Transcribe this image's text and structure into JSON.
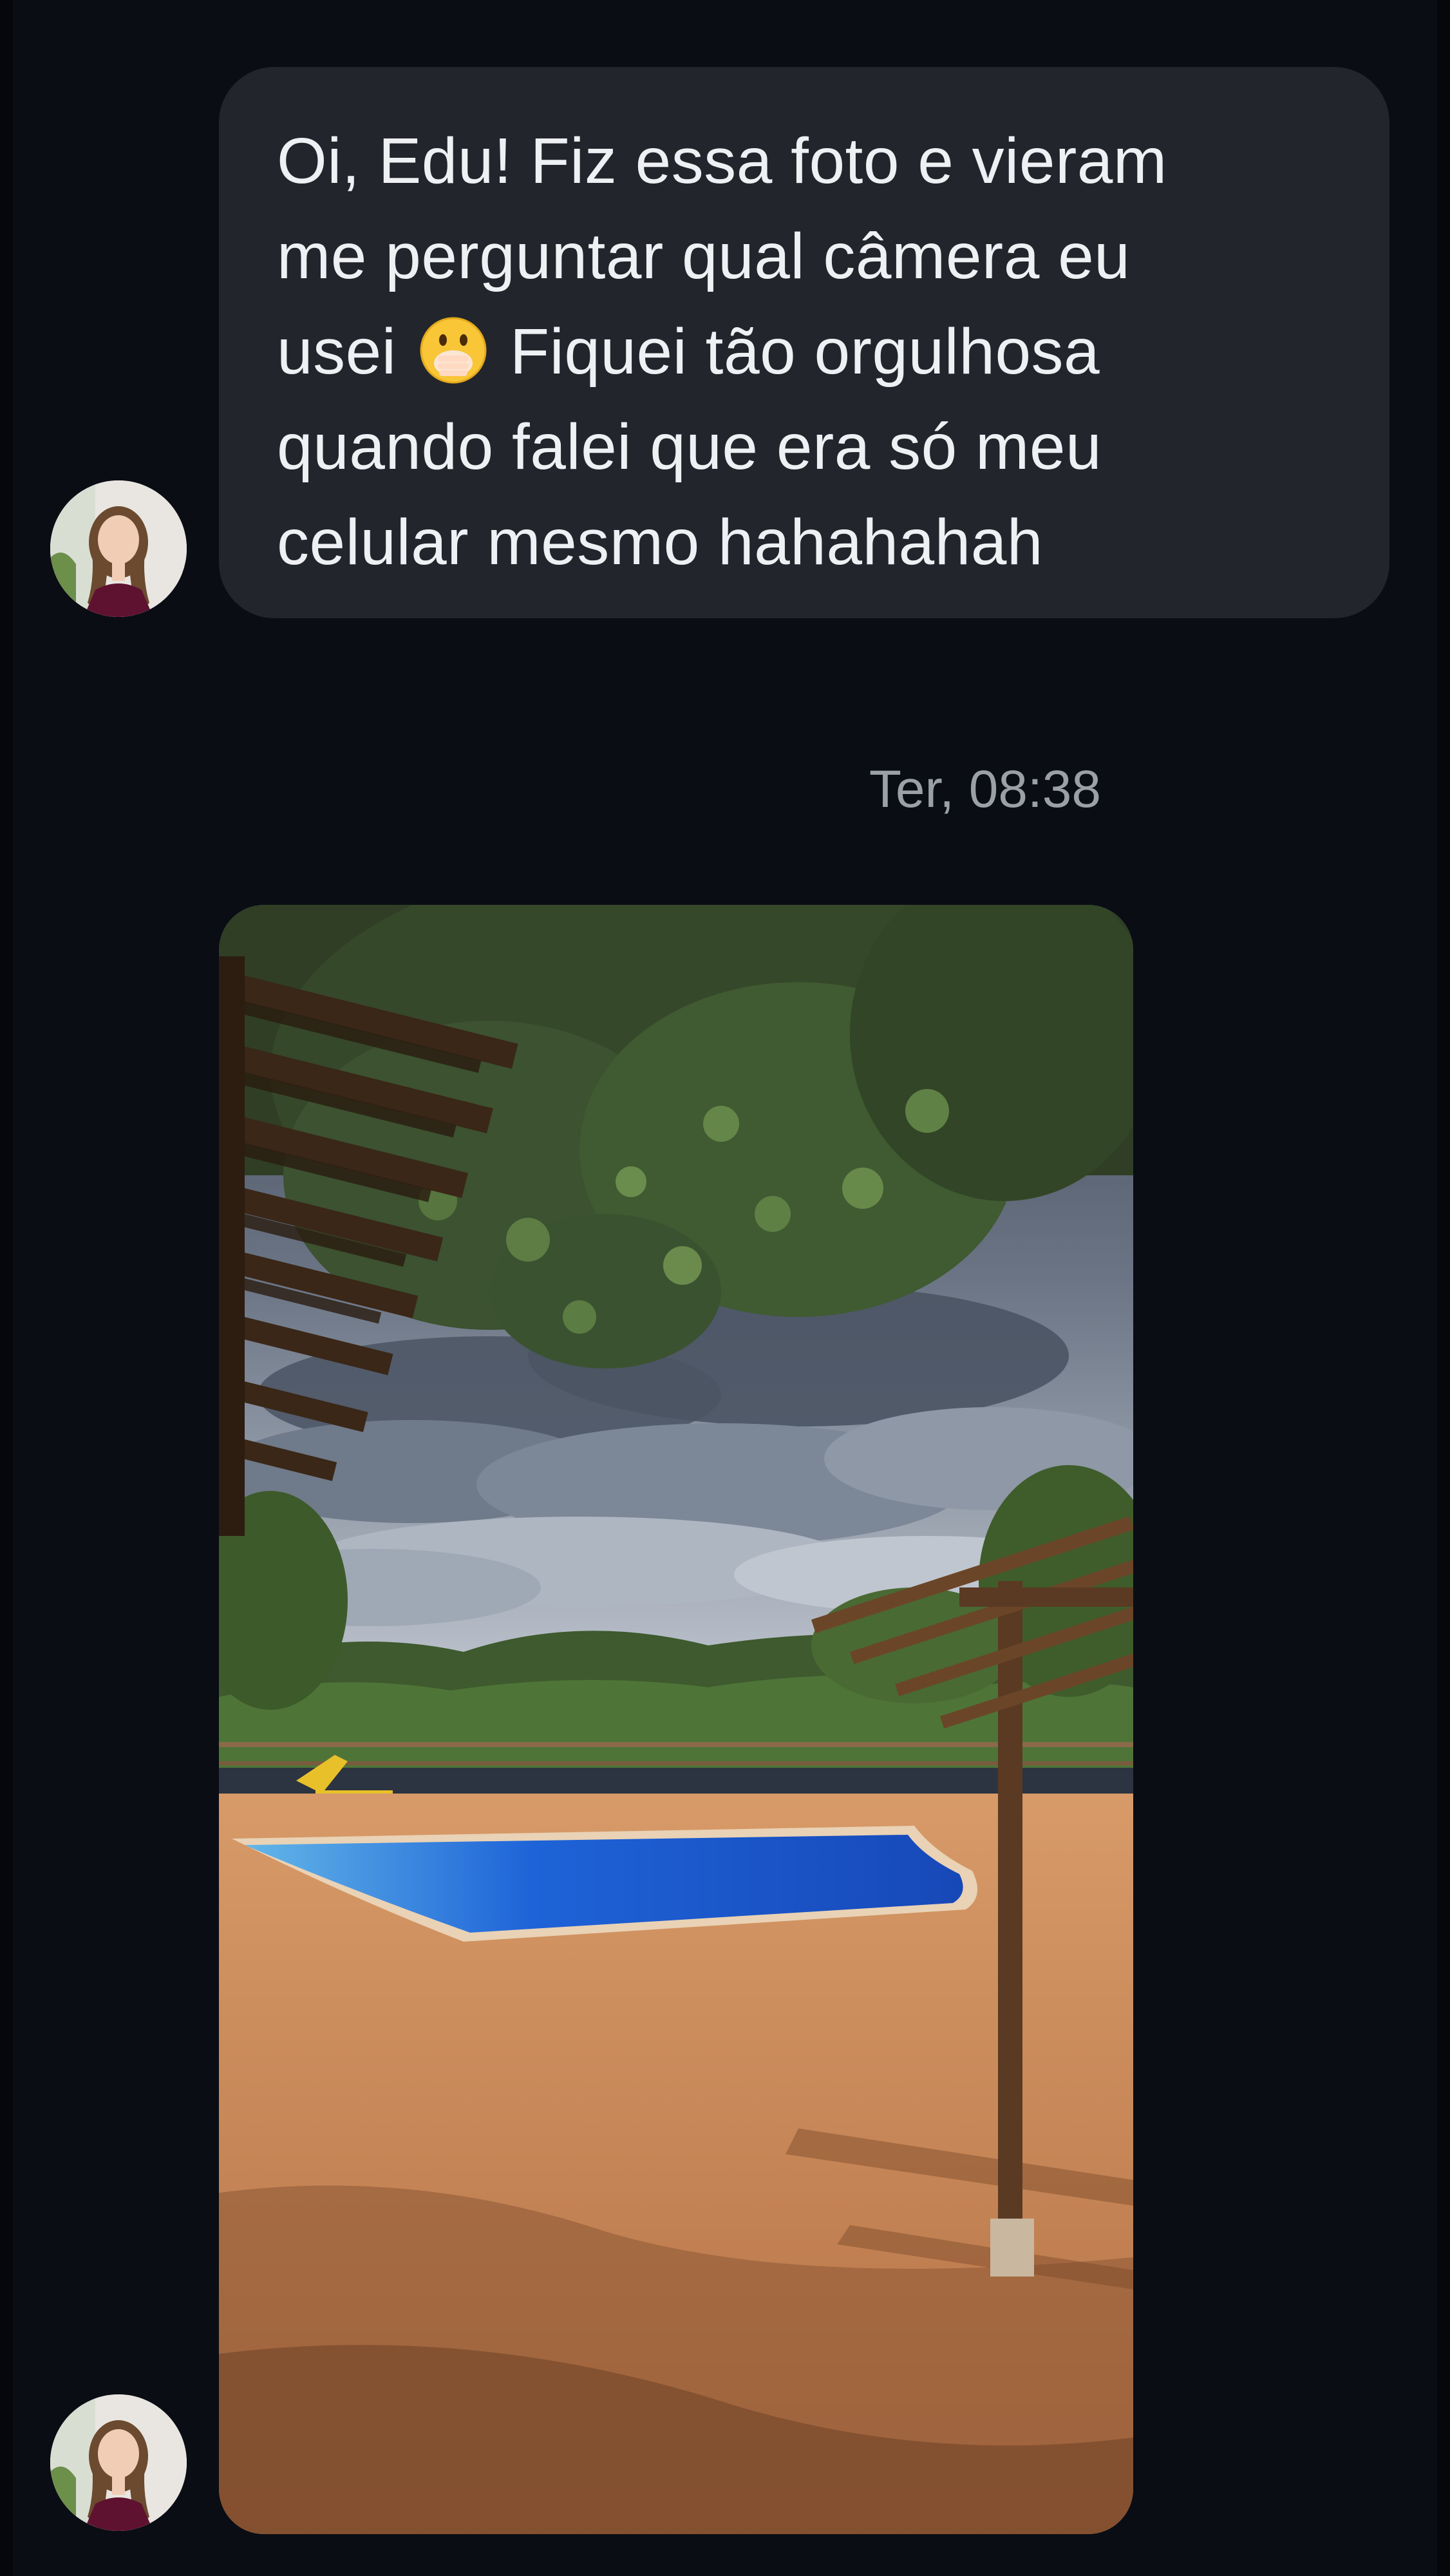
{
  "conversation": {
    "message_text": "Oi, Edu! Fiz essa foto e vieram\nme perguntar qual câmera eu\nusei [emoji] Fiquei tão orgulhosa\nquando falei que era só meu\ncelular mesmo hahahahah",
    "message_line1": "Oi, Edu! Fiz essa foto e vieram",
    "message_line2": "me perguntar qual câmera eu",
    "message_line3_before_emoji": "usei ",
    "message_line3_after_emoji": " Fiquei tão orgulhosa",
    "message_line4": "quando falei que era só meu",
    "message_line5": "celular mesmo hahahahah",
    "emoji_icon": "face-with-open-eyes-and-hand-over-mouth-icon",
    "timestamp": "Ter, 08:38",
    "photo_description_icon": "photo-attachment"
  },
  "colors": {
    "background": "#0a0d14",
    "bubble": "#22252c",
    "text": "#eef0f3",
    "timestamp": "#9ba0a8",
    "pool_water": "#1d5fd6"
  }
}
